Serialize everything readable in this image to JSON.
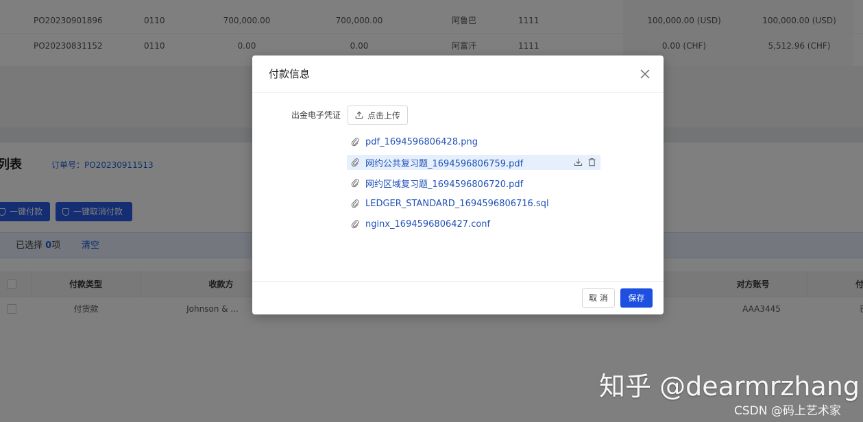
{
  "background": {
    "top_rows": [
      {
        "po": "PO20230901896",
        "code": "0110",
        "amount1": "700,000.00",
        "amount2": "700,000.00",
        "name": "阿鲁巴",
        "account": "1111",
        "amount3": "100,000.00 (USD)",
        "amount4": "100,000.00 (USD)"
      },
      {
        "po": "PO20230831152",
        "code": "0110",
        "amount1": "0.00",
        "amount2": "0.00",
        "name": "阿富汗",
        "account": "1111",
        "amount3": "0.00 (CHF)",
        "amount4": "5,512.96 (CHF)"
      }
    ],
    "section_title": "列表",
    "order_label": "订单号：PO20230911513",
    "pay_button": "一键付款",
    "cancel_pay_button": "一键取消付款",
    "selection": {
      "prefix": "已选择 ",
      "count": "0",
      "suffix": "项",
      "clear": "清空"
    },
    "table_headers": [
      "付款类型",
      "收款方",
      "对方账号",
      "付"
    ],
    "table_row": {
      "type": "付货款",
      "payee": "Johnson & ...",
      "account": "AAA3445",
      "last": "已"
    }
  },
  "modal": {
    "title": "付款信息",
    "field_label": "出金电子凭证",
    "upload_label": "点击上传",
    "files": [
      {
        "name": "pdf_1694596806428.png"
      },
      {
        "name": "网约公共复习题_1694596806759.pdf"
      },
      {
        "name": "网约区域复习题_1694596806720.pdf"
      },
      {
        "name": "LEDGER_STANDARD_1694596806716.sql"
      },
      {
        "name": "nginx_1694596806427.conf"
      }
    ],
    "cancel_label": "取 消",
    "save_label": "保存"
  },
  "watermark": {
    "main": "知乎 @dearmrzhang",
    "sub": "CSDN @码上艺术家"
  },
  "colors": {
    "primary": "#1d4fe0",
    "link": "#2050b8",
    "hover_row": "#e6f0fc",
    "overlay": "rgba(0,0,0,0.5)"
  }
}
